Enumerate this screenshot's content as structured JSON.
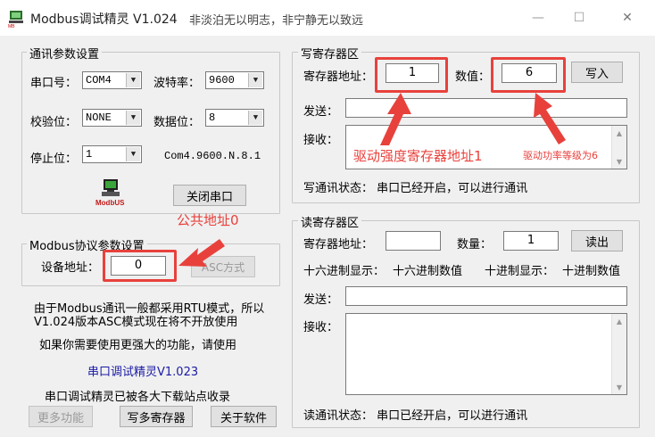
{
  "window": {
    "title": "Modbus调试精灵 V1.024",
    "motto": "非淡泊无以明志，非宁静无以致远",
    "icon": "modbus-app-icon",
    "controls": {
      "minimize": "—",
      "maximize": "☐",
      "close": "✕"
    }
  },
  "comm_params": {
    "title": "通讯参数设置",
    "port_label": "串口号：",
    "port_value": "COM4",
    "baud_label": "波特率：",
    "baud_value": "9600",
    "parity_label": "校验位：",
    "parity_value": "NONE",
    "databits_label": "数据位：",
    "databits_value": "8",
    "stopbits_label": "停止位：",
    "stopbits_value": "1",
    "summary": "Com4.9600.N.8.1",
    "modbus_icon_text": "ModbUS",
    "close_port_button": "关闭串口"
  },
  "protocol_params": {
    "title": "Modbus协议参数设置",
    "device_addr_label": "设备地址：",
    "device_addr_value": "0",
    "asc_button": "ASC方式"
  },
  "info": {
    "line1": "由于Modbus通讯一般都采用RTU模式，所以",
    "line2": "V1.024版本ASC模式现在将不开放使用",
    "line3": "如果你需要使用更强大的功能，请使用",
    "link": "串口调试精灵V1.023",
    "line4": "串口调试精灵已被各大下载站点收录"
  },
  "bottom_buttons": {
    "more": "更多功能",
    "write_multi": "写多寄存器",
    "about": "关于软件"
  },
  "write_reg": {
    "title": "写寄存器区",
    "addr_label": "寄存器地址：",
    "addr_value": "1",
    "value_label": "数值：",
    "value_value": "6",
    "write_button": "写入",
    "send_label": "发送：",
    "send_value": "",
    "recv_label": "接收：",
    "status": "写通讯状态：  串口已经开启，可以进行通讯"
  },
  "read_reg": {
    "title": "读寄存器区",
    "addr_label": "寄存器地址：",
    "addr_value": "",
    "qty_label": "数量：",
    "qty_value": "1",
    "read_button": "读出",
    "hex_label": "十六进制显示：",
    "hex_value": "十六进制数值",
    "dec_label": "十进制显示：",
    "dec_value": "十进制数值",
    "send_label": "发送：",
    "recv_label": "接收：",
    "status": "读通讯状态：  串口已经开启，可以进行通讯"
  },
  "annotations": {
    "drive_addr": "驱动强度寄存器地址1",
    "power_level": "驱动功率等级为6",
    "public_addr": "公共地址0",
    "color": "#e8413c"
  }
}
